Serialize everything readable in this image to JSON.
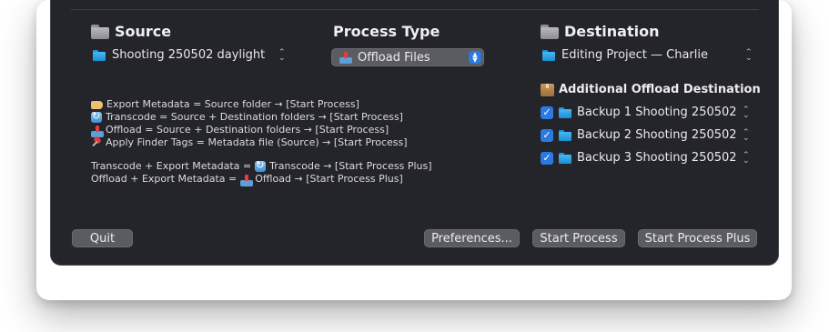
{
  "source": {
    "heading": "Source",
    "selected": "Shooting 250502 daylight"
  },
  "process": {
    "heading": "Process Type",
    "selected": "Offload Files"
  },
  "destination": {
    "heading": "Destination",
    "selected": "Editing Project — Charlie",
    "additional_heading": "Additional Offload Destination",
    "backups": [
      {
        "label": "Backup 1 Shooting 250502",
        "checked": true
      },
      {
        "label": "Backup 2 Shooting 250502",
        "checked": true
      },
      {
        "label": "Backup 3 Shooting 250502",
        "checked": true
      }
    ]
  },
  "info": {
    "lines": [
      "Export Metadata = Source folder → [Start Process]",
      "Transcode = Source + Destination folders → [Start Process]",
      "Offload = Source + Destination folders → [Start Process]",
      "Apply Finder Tags = Metadata file (Source) → [Start Process]"
    ],
    "combo": [
      {
        "pre": "Transcode + Export Metadata = ",
        "post": "Transcode → [Start Process Plus]"
      },
      {
        "pre": "Offload + Export Metadata = ",
        "post": "Offload → [Start Process Plus]"
      }
    ]
  },
  "buttons": {
    "quit": "Quit",
    "preferences": "Preferences...",
    "start": "Start Process",
    "start_plus": "Start Process Plus"
  },
  "colors": {
    "window_bg": "#24242b",
    "accent": "#2a7ae2",
    "button_bg": "#5b5b62"
  }
}
